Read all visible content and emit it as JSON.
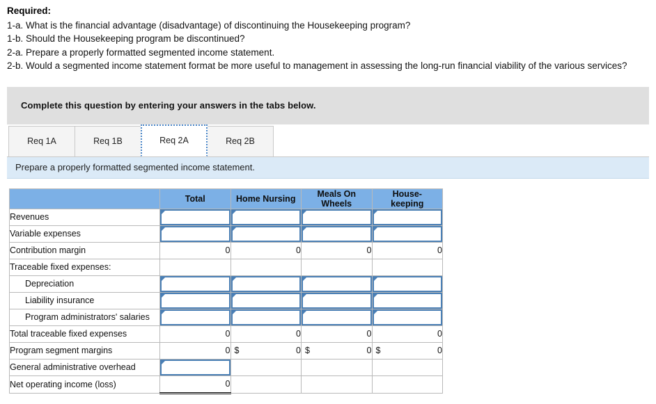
{
  "required": {
    "title": "Required:",
    "lines": [
      "1-a. What is the financial advantage (disadvantage) of discontinuing the Housekeeping program?",
      "1-b. Should the Housekeeping program be discontinued?",
      "2-a. Prepare a properly formatted segmented income statement.",
      "2-b. Would a segmented income statement format be more useful to management in assessing the long-run financial viability of the various services?"
    ]
  },
  "gray_banner": {
    "text": "Complete this question by entering your answers in the tabs below."
  },
  "tabs": [
    {
      "label": "Req 1A",
      "active": false
    },
    {
      "label": "Req 1B",
      "active": false
    },
    {
      "label": "Req 2A",
      "active": true
    },
    {
      "label": "Req 2B",
      "active": false
    }
  ],
  "blue_banner": {
    "text": "Prepare a properly formatted segmented income statement."
  },
  "colors": {
    "header_blue": "#7cb0e6",
    "banner_light_blue": "#dbeaf7",
    "banner_gray": "#dfdfdf",
    "input_border_blue": "#4a7fb5",
    "tab_focus_blue": "#4a86c8"
  },
  "table": {
    "columns": [
      "",
      "Total",
      "Home Nursing",
      "Meals On Wheels",
      "House-keeping"
    ],
    "column_labels_wrapped": [
      "",
      "Total",
      "Home Nursing",
      "Meals On\nWheels",
      "House-\nkeeping"
    ],
    "rows": [
      {
        "label": "Revenues",
        "indent": false,
        "cells": [
          {
            "kind": "input",
            "value": "",
            "dollar": false
          },
          {
            "kind": "input",
            "value": "",
            "dollar": false
          },
          {
            "kind": "input",
            "value": "",
            "dollar": false
          },
          {
            "kind": "input",
            "value": "",
            "dollar": false
          }
        ]
      },
      {
        "label": "Variable expenses",
        "indent": false,
        "cells": [
          {
            "kind": "input",
            "value": "",
            "dollar": false
          },
          {
            "kind": "input",
            "value": "",
            "dollar": false
          },
          {
            "kind": "input",
            "value": "",
            "dollar": false
          },
          {
            "kind": "input",
            "value": "",
            "dollar": false
          }
        ]
      },
      {
        "label": "Contribution margin",
        "indent": false,
        "rule_top": true,
        "cells": [
          {
            "kind": "computed",
            "value": "0",
            "dollar": false
          },
          {
            "kind": "computed",
            "value": "0",
            "dollar": false
          },
          {
            "kind": "computed",
            "value": "0",
            "dollar": false
          },
          {
            "kind": "computed",
            "value": "0",
            "dollar": false
          }
        ]
      },
      {
        "label": "Traceable fixed expenses:",
        "indent": false,
        "cells": [
          {
            "kind": "blank",
            "value": "",
            "dollar": false
          },
          {
            "kind": "blank",
            "value": "",
            "dollar": false
          },
          {
            "kind": "blank",
            "value": "",
            "dollar": false
          },
          {
            "kind": "blank",
            "value": "",
            "dollar": false
          }
        ]
      },
      {
        "label": "Depreciation",
        "indent": true,
        "cells": [
          {
            "kind": "input",
            "value": "",
            "dollar": false
          },
          {
            "kind": "input",
            "value": "",
            "dollar": false
          },
          {
            "kind": "input",
            "value": "",
            "dollar": false
          },
          {
            "kind": "input",
            "value": "",
            "dollar": false
          }
        ]
      },
      {
        "label": "Liability insurance",
        "indent": true,
        "cells": [
          {
            "kind": "input",
            "value": "",
            "dollar": false
          },
          {
            "kind": "input",
            "value": "",
            "dollar": false
          },
          {
            "kind": "input",
            "value": "",
            "dollar": false
          },
          {
            "kind": "input",
            "value": "",
            "dollar": false
          }
        ]
      },
      {
        "label": "Program administrators' salaries",
        "indent": true,
        "cells": [
          {
            "kind": "input",
            "value": "",
            "dollar": false
          },
          {
            "kind": "input",
            "value": "",
            "dollar": false
          },
          {
            "kind": "input",
            "value": "",
            "dollar": false
          },
          {
            "kind": "input",
            "value": "",
            "dollar": false
          }
        ]
      },
      {
        "label": "Total traceable fixed expenses",
        "indent": false,
        "rule_top": true,
        "cells": [
          {
            "kind": "computed",
            "value": "0",
            "dollar": false
          },
          {
            "kind": "computed",
            "value": "0",
            "dollar": false
          },
          {
            "kind": "computed",
            "value": "0",
            "dollar": false
          },
          {
            "kind": "computed",
            "value": "0",
            "dollar": false
          }
        ]
      },
      {
        "label": "Program segment margins",
        "indent": false,
        "cells": [
          {
            "kind": "computed",
            "value": "0",
            "dollar": false
          },
          {
            "kind": "computed",
            "value": "0",
            "dollar": true,
            "dollar_text": "$"
          },
          {
            "kind": "computed",
            "value": "0",
            "dollar": true,
            "dollar_text": "$"
          },
          {
            "kind": "computed",
            "value": "0",
            "dollar": true,
            "dollar_text": "$"
          }
        ]
      },
      {
        "label": "General administrative overhead",
        "indent": false,
        "cells": [
          {
            "kind": "input",
            "value": "",
            "dollar": false
          },
          {
            "kind": "blank",
            "value": "",
            "dollar": false
          },
          {
            "kind": "blank",
            "value": "",
            "dollar": false
          },
          {
            "kind": "blank",
            "value": "",
            "dollar": false
          }
        ]
      },
      {
        "label": "Net operating income (loss)",
        "indent": false,
        "double_bottom": true,
        "cells": [
          {
            "kind": "computed",
            "value": "0",
            "dollar": false,
            "double": true
          },
          {
            "kind": "blank",
            "value": "",
            "dollar": false
          },
          {
            "kind": "blank",
            "value": "",
            "dollar": false
          },
          {
            "kind": "blank",
            "value": "",
            "dollar": false
          }
        ]
      }
    ]
  }
}
